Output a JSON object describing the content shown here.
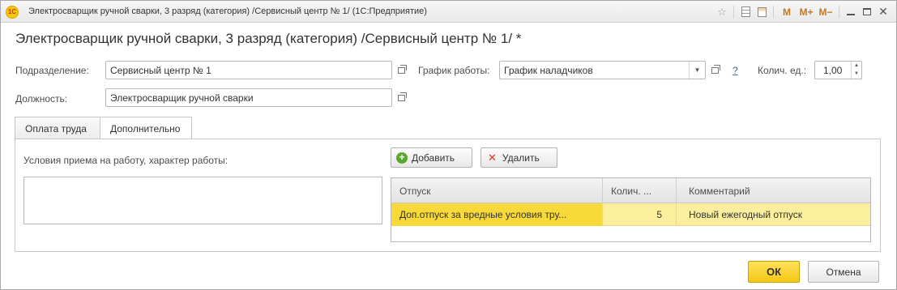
{
  "window": {
    "title": "Электросварщик ручной сварки, 3 разряд (категория) /Сервисный центр № 1/  (1С:Предприятие)",
    "logo_text": "1С",
    "controls": {
      "m_label": "M",
      "m_plus_label": "M+",
      "m_minus_label": "M−"
    }
  },
  "form": {
    "heading": "Электросварщик ручной сварки, 3 разряд (категория) /Сервисный центр № 1/ *",
    "subdivision": {
      "label": "Подразделение:",
      "value": "Сервисный центр № 1"
    },
    "schedule": {
      "label": "График работы:",
      "value": "График наладчиков",
      "help": "?"
    },
    "quantity": {
      "label": "Колич. ед.:",
      "value": "1,00"
    },
    "position": {
      "label": "Должность:",
      "value": "Электросварщик ручной сварки"
    }
  },
  "tabs": [
    {
      "label": "Оплата труда",
      "active": false
    },
    {
      "label": "Дополнительно",
      "active": true
    }
  ],
  "additional": {
    "conditions_label": "Условия приема на работу, характер работы:",
    "conditions_value": "",
    "add_button": "Добавить",
    "delete_button": "Удалить",
    "table": {
      "columns": [
        "Отпуск",
        "Колич. ...",
        "Комментарий"
      ],
      "rows": [
        {
          "vacation": "Доп.отпуск за вредные условия тру...",
          "quantity": "5",
          "comment": "Новый ежегодный отпуск"
        }
      ]
    }
  },
  "footer": {
    "ok_label": "ОК",
    "cancel_label": "Отмена"
  },
  "colors": {
    "selected_cell": "#f7d93a",
    "selected_row": "#fbef9e",
    "ok_button": "#f4c814",
    "link": "#3a6fb0"
  }
}
